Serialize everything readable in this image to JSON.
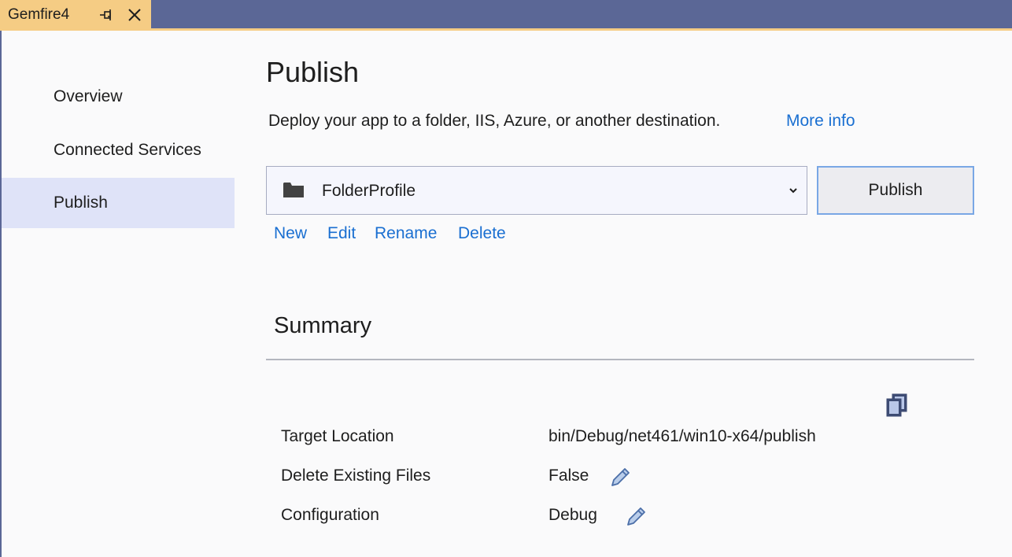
{
  "tab": {
    "title": "Gemfire4",
    "pin_icon": "pin-icon",
    "close_icon": "close-icon",
    "color": "#f5cc84"
  },
  "sidebar": {
    "items": [
      {
        "label": "Overview",
        "active": false
      },
      {
        "label": "Connected Services",
        "active": false
      },
      {
        "label": "Publish",
        "active": true
      }
    ]
  },
  "main": {
    "title": "Publish",
    "description": "Deploy your app to a folder, IIS, Azure, or another destination.",
    "more_info_label": "More info",
    "profile": {
      "icon": "folder-icon",
      "selected": "FolderProfile"
    },
    "publish_button_label": "Publish",
    "actions": [
      {
        "label": "New"
      },
      {
        "label": "Edit"
      },
      {
        "label": "Rename"
      },
      {
        "label": "Delete"
      }
    ]
  },
  "summary": {
    "title": "Summary",
    "rows": [
      {
        "label": "Target Location",
        "value": "bin/Debug/net461/win10-x64/publish",
        "icon": "copy-icon"
      },
      {
        "label": "Delete Existing Files",
        "value": "False",
        "icon": "pencil-icon"
      },
      {
        "label": "Configuration",
        "value": "Debug",
        "icon": "pencil-icon"
      }
    ]
  },
  "colors": {
    "link": "#1a6fd1",
    "title_bar": "#5b6796",
    "sidebar_active": "#dfe3f8",
    "button_border": "#79a7e5"
  }
}
